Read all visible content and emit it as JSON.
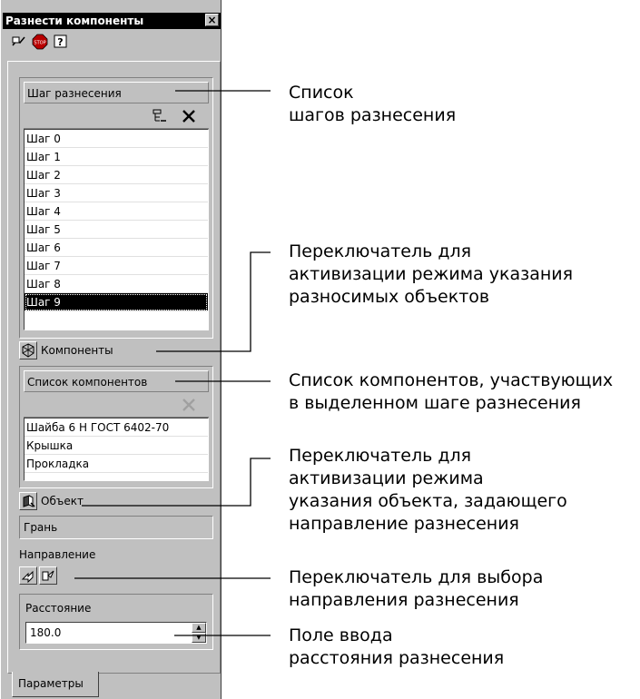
{
  "window": {
    "title": "Разнести компоненты",
    "close_label": "×"
  },
  "toolbar": {
    "icons": [
      "apply-icon",
      "stop-icon",
      "help-icon"
    ]
  },
  "steps": {
    "header": "Шаг разнесения",
    "items": [
      "Шаг 0",
      "Шаг 1",
      "Шаг 2",
      "Шаг 3",
      "Шаг 4",
      "Шаг 5",
      "Шаг 6",
      "Шаг 7",
      "Шаг 8",
      "Шаг 9"
    ],
    "selected_index": 9
  },
  "components_toggle": {
    "label": "Компоненты"
  },
  "components": {
    "header": "Список компонентов",
    "items": [
      "Шайба 6 Н ГОСТ 6402-70",
      "Крышка",
      "Прокладка"
    ]
  },
  "object_toggle": {
    "label": "Объект"
  },
  "object_field": {
    "value": "Грань"
  },
  "direction": {
    "label": "Направление"
  },
  "distance": {
    "label": "Расстояние",
    "value": "180.0"
  },
  "tab": {
    "label": "Параметры"
  },
  "annotations": {
    "steps_list": "Список\nшагов разнесения",
    "components_toggle": "Переключатель для\nактивизации режима указания\nразносимых объектов",
    "components_list": "Список компонентов, участвующих\nв выделенном шаге разнесения",
    "object_toggle": "Переключатель для\nактивизации режима\nуказания объекта, задающего\nнаправление разнесения",
    "direction_toggle": "Переключатель для выбора\nнаправления разнесения",
    "distance_field": "Поле ввода\nрасстояния разнесения"
  }
}
